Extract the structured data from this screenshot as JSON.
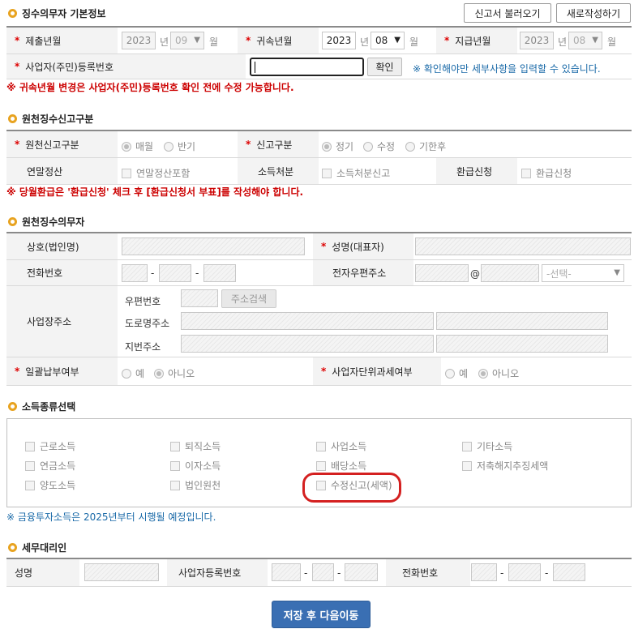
{
  "header": {
    "title": "징수의무자 기본정보",
    "load_btn": "신고서 불러오기",
    "new_btn": "새로작성하기"
  },
  "basic": {
    "submit_label": "제출년월",
    "submit_year": "2023",
    "year_unit": "년",
    "submit_month": "09",
    "month_unit": "월",
    "belong_label": "귀속년월",
    "belong_year": "2023",
    "belong_month": "08",
    "pay_label": "지급년월",
    "pay_year": "2023",
    "pay_month": "08",
    "bizno_label": "사업자(주민)등록번호",
    "confirm_btn": "확인",
    "confirm_note": "※ 확인해야만 세부사항을 입력할 수 있습니다."
  },
  "note1": "※ 귀속년월 변경은 사업자(주민)등록번호 확인 전에 수정 가능합니다.",
  "report": {
    "title": "원천징수신고구분",
    "type_label": "원천신고구분",
    "type_opts": [
      "매월",
      "반기"
    ],
    "kind_label": "신고구분",
    "kind_opts": [
      "정기",
      "수정",
      "기한후"
    ],
    "yearend_label": "연말정산",
    "yearend_opt": "연말정산포함",
    "income_label": "소득처분",
    "income_opt": "소득처분신고",
    "refund_label": "환급신청",
    "refund_opt": "환급신청"
  },
  "note2": "※ 당월환급은 '환급신청' 체크 후 [환급신청서 부표]를 작성해야 합니다.",
  "agent": {
    "title": "원천징수의무자",
    "company_label": "상호(법인명)",
    "name_label": "성명(대표자)",
    "phone_label": "전화번호",
    "dash": "-",
    "email_label": "전자우편주소",
    "at": "@",
    "email_select": "-선택-",
    "addr_label": "사업장주소",
    "zip_label": "우편번호",
    "zip_btn": "주소검색",
    "road_label": "도로명주소",
    "lot_label": "지번주소",
    "bulk_label": "일괄납부여부",
    "yes": "예",
    "no": "아니오",
    "unit_label": "사업자단위과세여부"
  },
  "income": {
    "title": "소득종류선택",
    "items": [
      [
        "근로소득",
        "퇴직소득",
        "사업소득",
        "기타소득"
      ],
      [
        "연금소득",
        "이자소득",
        "배당소득",
        "저축해지추징세액"
      ],
      [
        "양도소득",
        "법인원천",
        "수정신고(세액)"
      ]
    ],
    "note": "※ 금융투자소득은 2025년부터 시행될 예정입니다.",
    "highlight_color": "#d42020"
  },
  "tax_agent": {
    "title": "세무대리인",
    "name_label": "성명",
    "bizno_label": "사업자등록번호",
    "phone_label": "전화번호",
    "dash": "-"
  },
  "save_btn": "저장 후 다음이동"
}
